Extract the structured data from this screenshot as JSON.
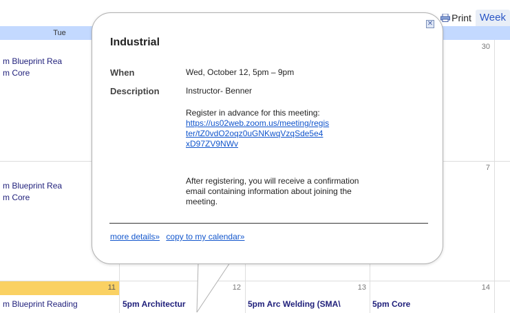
{
  "toolbar": {
    "print_label": "Print",
    "week_label": "Week"
  },
  "calendar": {
    "header": {
      "tue": "Tue"
    },
    "rows": [
      {
        "day_numbers": {
          "col4": "30"
        },
        "events": [
          "m Blueprint Rea",
          "m Core"
        ]
      },
      {
        "day_numbers": {
          "col4": "7"
        },
        "events": [
          "m Blueprint Rea",
          "m Core"
        ]
      },
      {
        "day_numbers": {
          "col1": "11",
          "col2": "12",
          "col3": "13",
          "col4": "14"
        },
        "events": {
          "col1": "m Blueprint Reading",
          "col2": "5pm Architectur",
          "col3": "5pm Arc Welding (SMA\\",
          "col4": "5pm Core"
        }
      }
    ],
    "today_color": "#fad163",
    "header_color": "#c3d9ff"
  },
  "popup": {
    "title": "Industrial",
    "when_label": "When",
    "when_value": "Wed, October 12, 5pm – 9pm",
    "description_label": "Description",
    "description_lines": [
      "Instructor- Benner",
      "Register in advance for this meeting:"
    ],
    "link_lines": [
      "https://us02web.zoom.us/meeting/regis",
      "ter/tZ0vdO2oqz0uGNKwqVzqSde5e4",
      "xD97ZV9NWv"
    ],
    "after_text_lines": [
      "After registering, you will receive a confirmation",
      "email containing information about joining the",
      "meeting."
    ],
    "more_details": "more details»",
    "copy_to_calendar": "copy to my calendar»",
    "close_icon": "close-icon"
  }
}
